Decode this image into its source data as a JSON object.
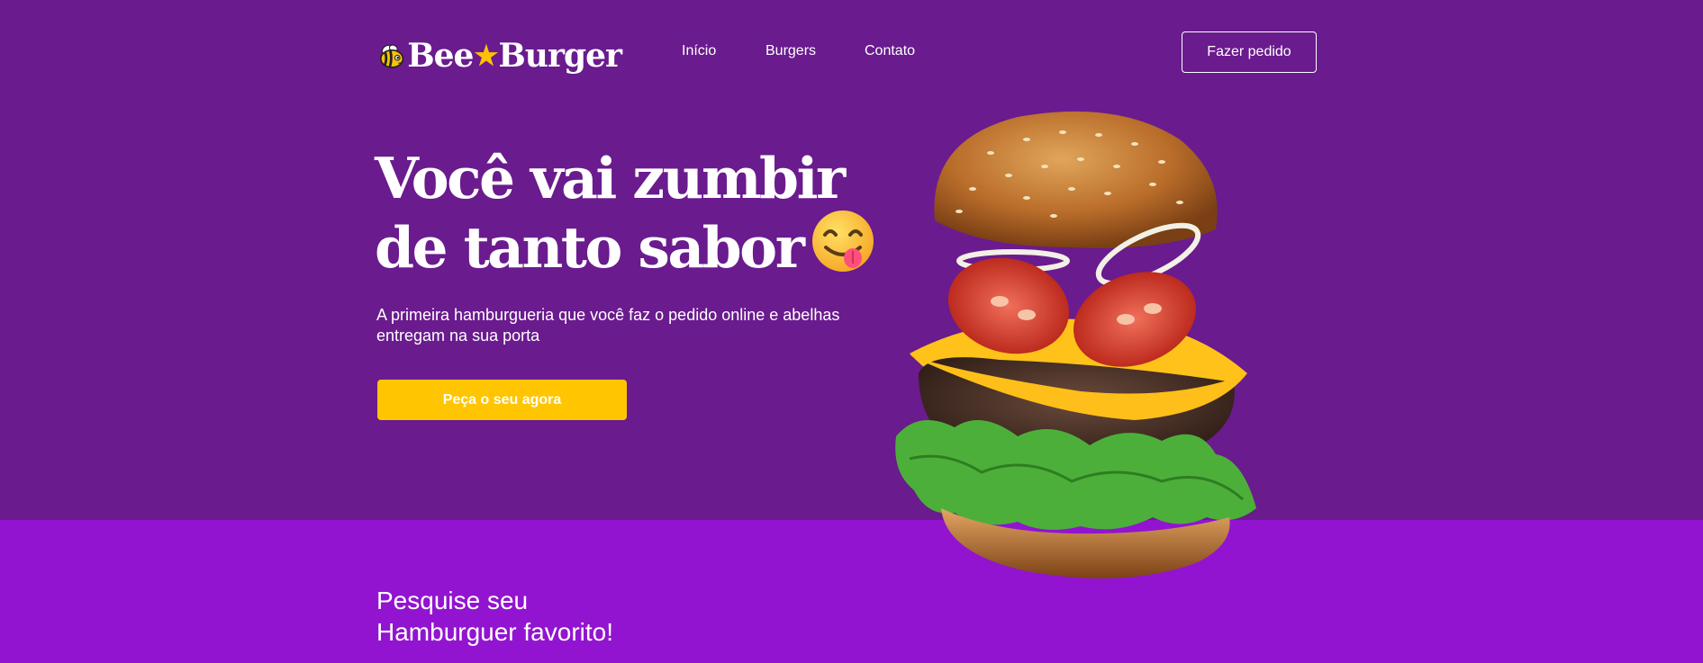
{
  "brand": {
    "name_part1": "Bee",
    "name_part2": "Burger",
    "logo_icon": "bee-icon",
    "star_icon": "star-icon"
  },
  "nav": {
    "items": [
      {
        "label": "Início"
      },
      {
        "label": "Burgers"
      },
      {
        "label": "Contato"
      }
    ],
    "order_button": "Fazer pedido"
  },
  "hero": {
    "headline_line1": "Você vai zumbir",
    "headline_line2": "de tanto sabor",
    "headline_emoji": "face-savoring-food-icon",
    "subtitle": "A primeira hamburgueria que você faz o pedido online e abelhas entregam na sua porta",
    "cta_label": "Peça o seu agora",
    "image": "floating-burger"
  },
  "search_section": {
    "title_line1": "Pesquise seu",
    "title_line2": "Hamburguer favorito!"
  },
  "colors": {
    "hero_bg": "#6a1b8e",
    "section_bg": "#9214d0",
    "accent_yellow": "#ffc500",
    "text": "#ffffff"
  }
}
